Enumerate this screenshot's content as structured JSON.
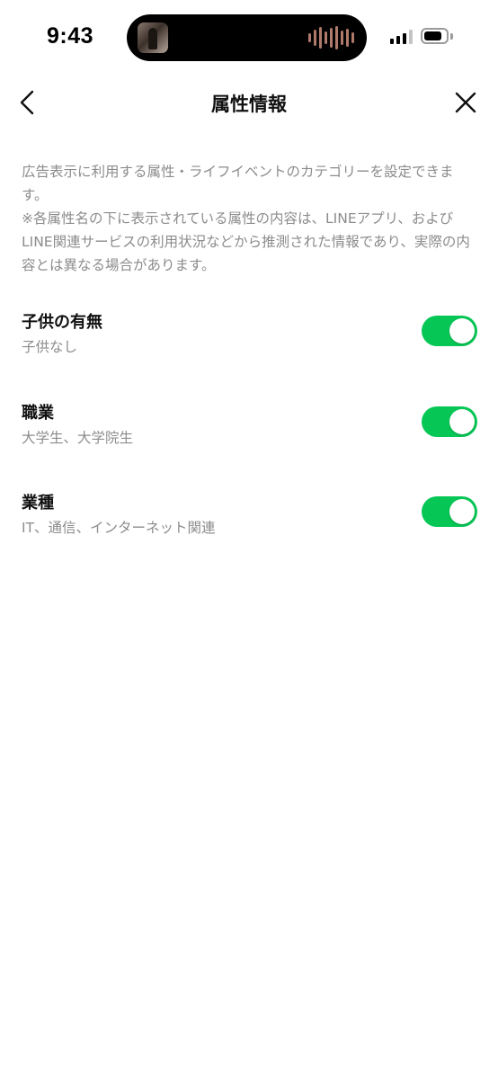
{
  "status_bar": {
    "time": "9:43"
  },
  "header": {
    "title": "属性情報",
    "back_icon": "chevron-left-icon",
    "close_icon": "close-icon"
  },
  "description": {
    "line1": "広告表示に利用する属性・ライフイベントのカテゴリーを設定できます。",
    "line2": "※各属性名の下に表示されている属性の内容は、LINEアプリ、およびLINE関連サービスの利用状況などから推測された情報であり、実際の内容とは異なる場合があります。"
  },
  "settings": [
    {
      "title": "子供の有無",
      "value": "子供なし",
      "enabled": true
    },
    {
      "title": "職業",
      "value": "大学生、大学院生",
      "enabled": true
    },
    {
      "title": "業種",
      "value": "IT、通信、インターネット関連",
      "enabled": true
    }
  ],
  "colors": {
    "toggle_on": "#06c755",
    "secondary_text": "#8c8c8c"
  }
}
